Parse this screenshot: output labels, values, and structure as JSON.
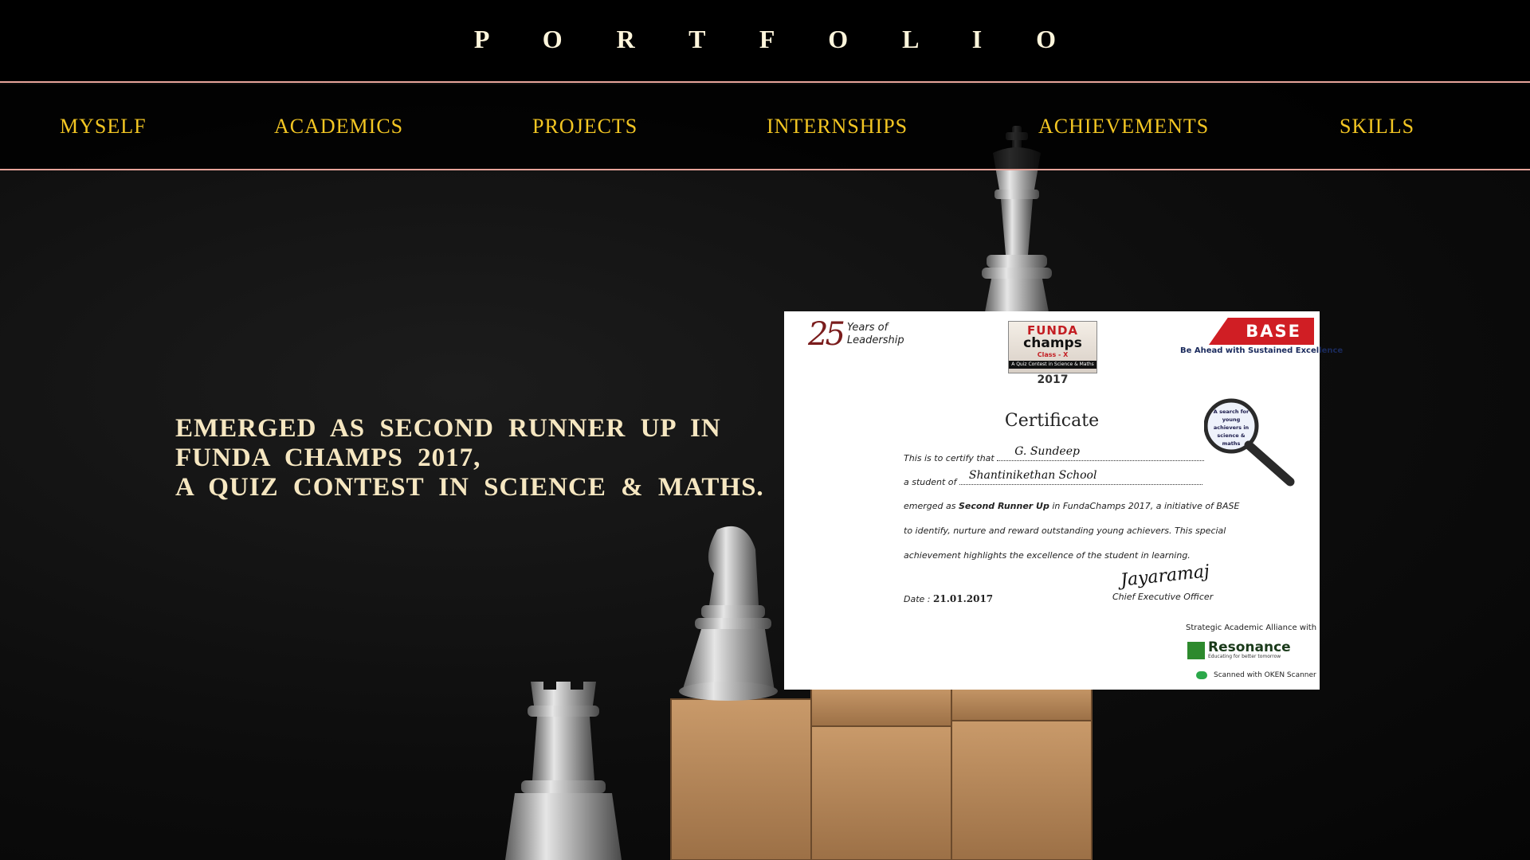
{
  "header": {
    "title": "P O R T F O L I O"
  },
  "nav": {
    "items": [
      {
        "label": "MYSELF"
      },
      {
        "label": "ACADEMICS"
      },
      {
        "label": "PROJECTS"
      },
      {
        "label": "INTERNSHIPS"
      },
      {
        "label": "ACHIEVEMENTS"
      },
      {
        "label": "SKILLS"
      }
    ]
  },
  "hero": {
    "lines": [
      "EMERGED AS SECOND RUNNER UP IN",
      "FUNDA CHAMPS 2017,",
      "A QUIZ CONTEST IN SCIENCE & MATHS."
    ]
  },
  "certificate": {
    "years_number": "25",
    "years_text_1": "Years of",
    "years_text_2": "Leadership",
    "funda_line1": "FUNDA",
    "funda_line2": "champs",
    "funda_line3": "Class - X",
    "funda_line4": "A Quiz Contest in Science & Maths",
    "funda_year": "2017",
    "base_logo": "BASE",
    "base_tagline": "Be Ahead with Sustained Excellence",
    "magnifier_text": "A search for young achievers in science & maths",
    "heading": "Certificate",
    "certify_prefix": "This is to certify that",
    "student_name": "G. Sundeep",
    "student_of_prefix": "a student of",
    "school_name": "Shantinikethan School",
    "line3_prefix": "emerged as",
    "line3_bold": "Second Runner Up",
    "line3_suffix": "in FundaChamps 2017, a initiative of BASE",
    "line4": "to identify, nurture and reward outstanding young achievers. This special",
    "line5": "achievement highlights the excellence of the student in learning.",
    "date_label": "Date :",
    "date_value": "21.01.2017",
    "signature": "Jayaramaj",
    "ceo_label": "Chief Executive Officer",
    "alliance_label": "Strategic Academic Alliance with",
    "resonance_name": "Resonance",
    "resonance_tagline": "Educating for better tomorrow",
    "scanned_label": "Scanned with OKEN Scanner"
  },
  "colors": {
    "header_bg": "#000000",
    "divider": "#e7a49a",
    "title": "#fff6dc",
    "nav_text": "#f3c623",
    "hero_text": "#f6e7c1",
    "block_wood": "#b88a5c",
    "chess_silver": "#b8b8b8"
  }
}
